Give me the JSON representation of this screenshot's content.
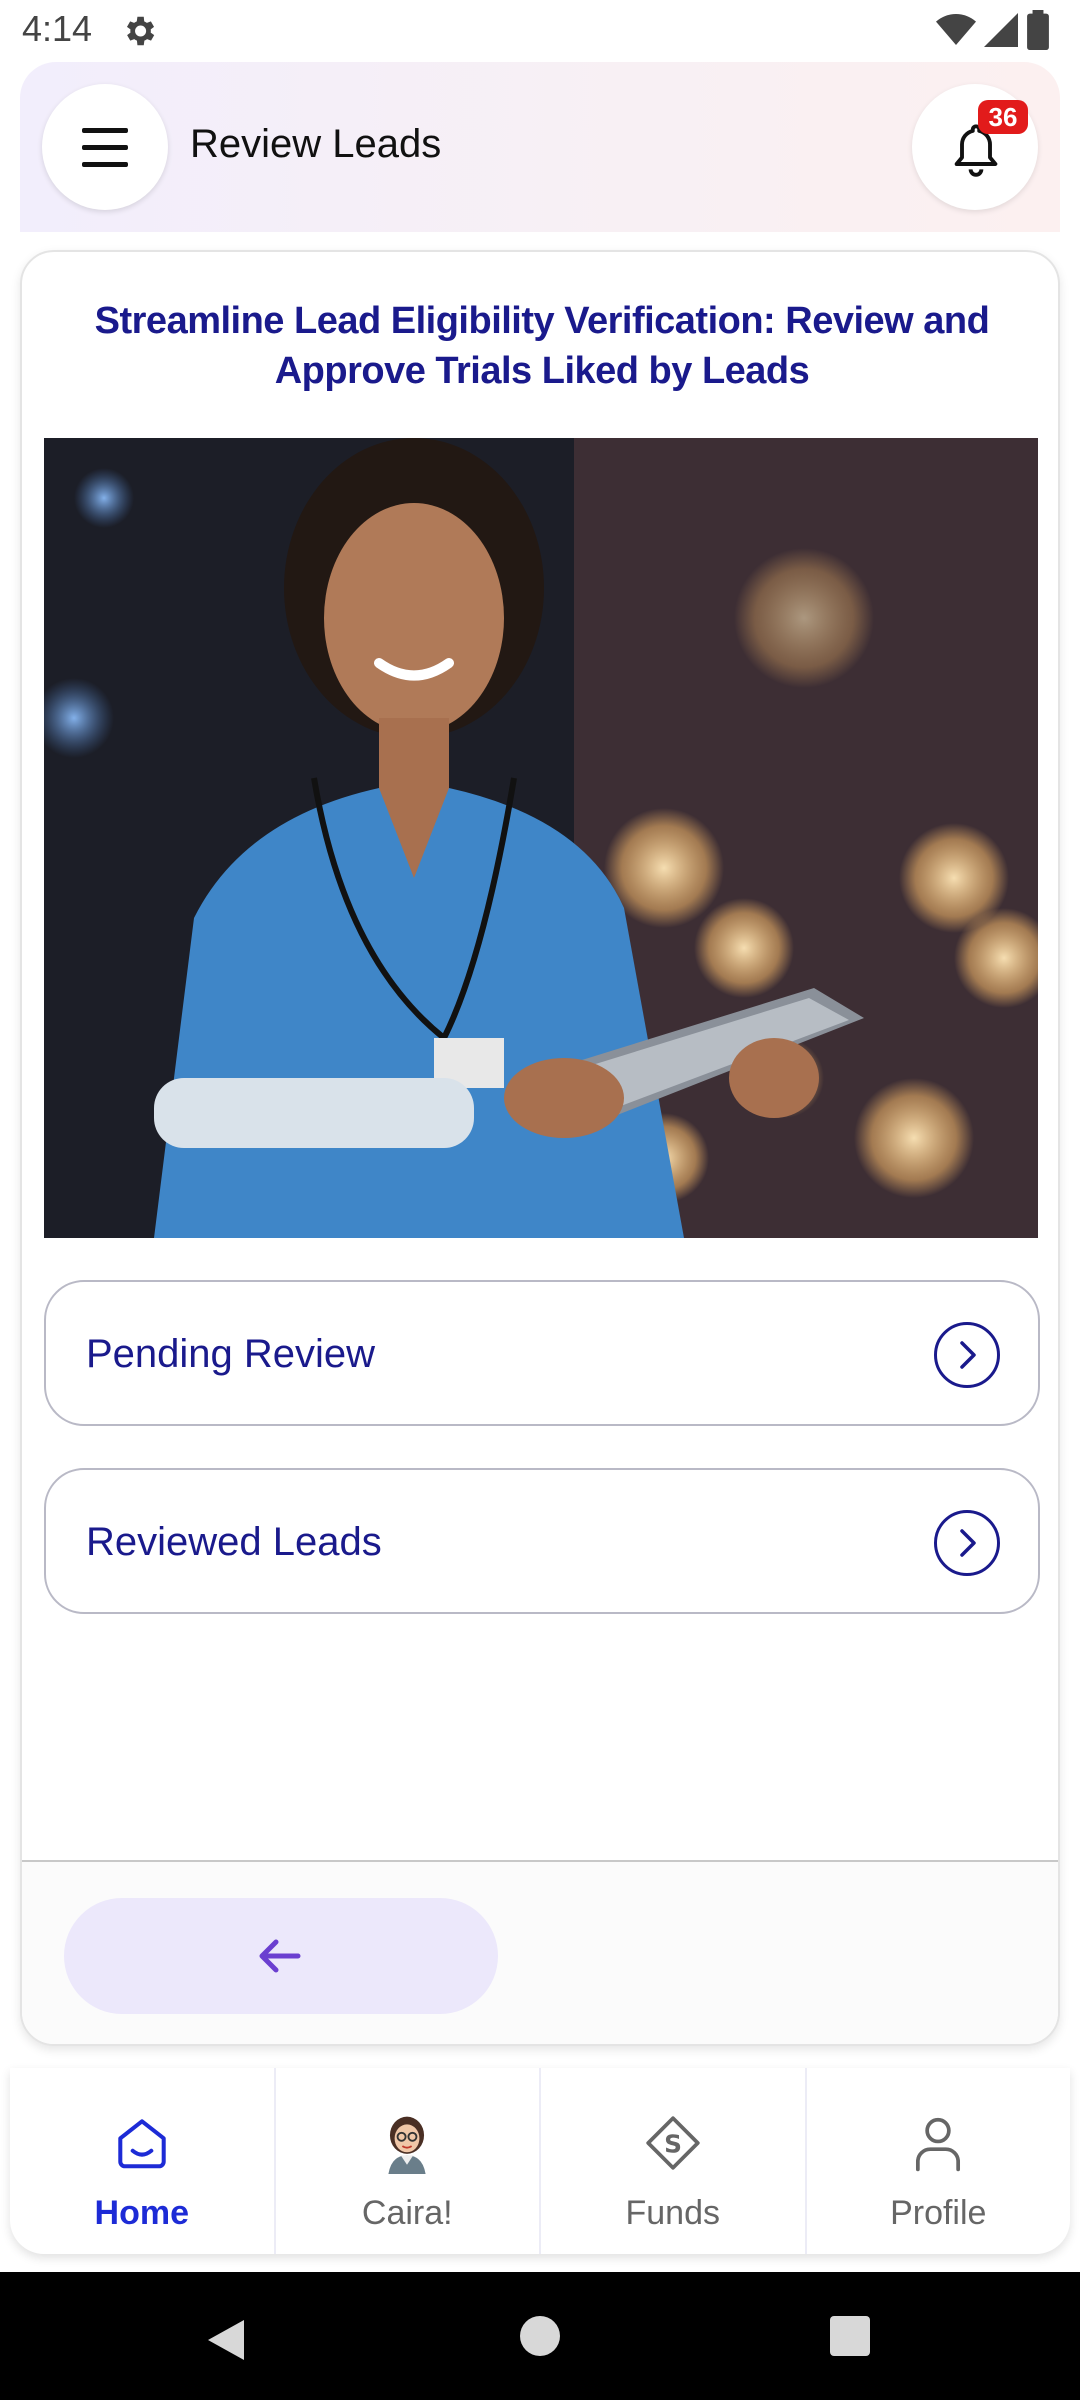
{
  "status_bar": {
    "time": "4:14"
  },
  "header": {
    "title": "Review Leads",
    "notification_count": "36"
  },
  "card": {
    "title": "Streamline Lead Eligibility Verification: Review and Approve Trials Liked by Leads",
    "rows": [
      {
        "label": "Pending Review"
      },
      {
        "label": "Reviewed Leads"
      }
    ]
  },
  "bottom_nav": {
    "items": [
      {
        "label": "Home",
        "icon": "home-icon",
        "active": true
      },
      {
        "label": "Caira!",
        "icon": "caira-avatar-icon",
        "active": false
      },
      {
        "label": "Funds",
        "icon": "funds-icon",
        "active": false
      },
      {
        "label": "Profile",
        "icon": "profile-icon",
        "active": false
      }
    ]
  },
  "colors": {
    "primary": "#1a1a8c",
    "active_nav": "#1d2bd6",
    "badge": "#e21b1b",
    "back_button_bg": "#ece8fb",
    "back_arrow": "#6b3fd0"
  }
}
